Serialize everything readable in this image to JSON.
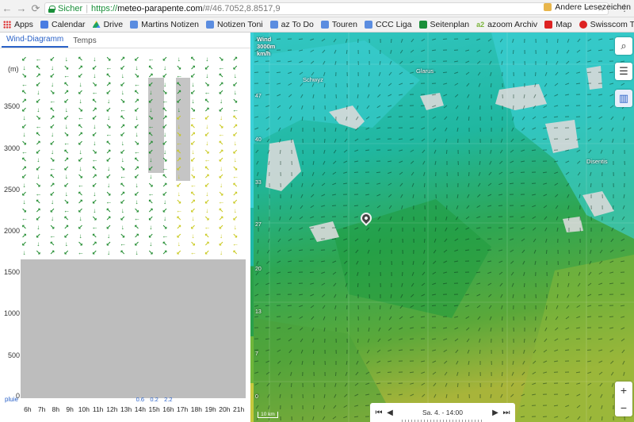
{
  "browser": {
    "secure_label": "Sicher",
    "url_protocol": "https://",
    "url_host": "meteo-parapente.com",
    "url_path": "/#/46.7052,8.8517,9",
    "bookmarks": [
      {
        "label": "Apps",
        "icon": "apps-grid-icon"
      },
      {
        "label": "Calendar",
        "icon": "calendar-icon"
      },
      {
        "label": "Drive",
        "icon": "drive-icon"
      },
      {
        "label": "Martins Notizen",
        "icon": "document-icon"
      },
      {
        "label": "Notizen Toni",
        "icon": "document-icon"
      },
      {
        "label": "az To Do",
        "icon": "document-icon"
      },
      {
        "label": "Touren",
        "icon": "document-icon"
      },
      {
        "label": "CCC Liga",
        "icon": "document-icon"
      },
      {
        "label": "Seitenplan",
        "icon": "green-document-icon"
      },
      {
        "label": "azoom Archiv",
        "icon": "a2-icon"
      },
      {
        "label": "Map",
        "icon": "swiss-flag-icon"
      },
      {
        "label": "Swisscom TV",
        "icon": "swisscom-icon"
      }
    ],
    "other_bookmarks": "Andere Lesezeichen"
  },
  "panel": {
    "tabs": [
      "Wind-Diagramm",
      "Temps"
    ],
    "altitude_unit": "(m)",
    "y_ticks": [
      "3500",
      "3000",
      "2500",
      "2000",
      "1500",
      "1000",
      "500",
      "0"
    ],
    "hours": [
      "6h",
      "7h",
      "8h",
      "9h",
      "10h",
      "11h",
      "12h",
      "13h",
      "14h",
      "15h",
      "16h",
      "17h",
      "18h",
      "19h",
      "20h",
      "21h"
    ],
    "rain_label": "pluie",
    "rain": [
      "",
      "",
      "",
      "",
      "",
      "",
      "",
      "",
      "0.6",
      "0.2",
      "2.2",
      "",
      "",
      "",
      "",
      ""
    ],
    "colors": {
      "thermal": "#f3f36a",
      "ground": "#bdbdbd",
      "arrow": "#1d8a2c",
      "rain": "#2a62c8"
    }
  },
  "map": {
    "legend_title": "Wind",
    "legend_subtitle": "3000m",
    "legend_unit": "km/h",
    "scale_values": [
      "47",
      "40",
      "33",
      "27",
      "20",
      "13",
      "7",
      "0"
    ],
    "time_label": "Sa. 4. - 14:00",
    "scale_label": "10 km",
    "place_labels": [
      "Schwyz",
      "Glarus",
      "Disentis"
    ],
    "controls": [
      "search-icon",
      "layers-settings-icon",
      "chart-icon"
    ],
    "zoom_in": "+",
    "zoom_out": "−"
  }
}
